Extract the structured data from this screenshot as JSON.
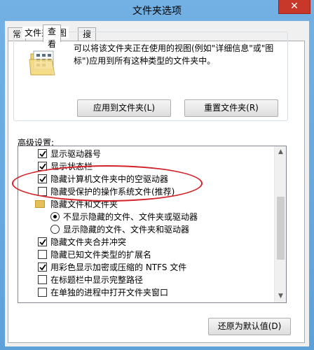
{
  "window": {
    "title": "文件夹选项",
    "close_glyph": "✕"
  },
  "tabs": [
    {
      "label": "常规",
      "active": false
    },
    {
      "label": "查看",
      "active": true
    },
    {
      "label": "搜索",
      "active": false
    }
  ],
  "folder_views": {
    "title": "文件夹视图",
    "description": "可以将该文件夹正在使用的视图(例如\"详细信息\"或\"图标\")应用到所有这种类型的文件夹中。",
    "apply_button": "应用到文件夹(L)",
    "reset_button": "重置文件夹(R)"
  },
  "advanced": {
    "label": "高级设置:",
    "items": [
      {
        "type": "checkbox",
        "label": "显示驱动器号",
        "checked": true
      },
      {
        "type": "checkbox",
        "label": "显示状态栏",
        "checked": true
      },
      {
        "type": "checkbox",
        "label": "隐藏计算机文件夹中的空驱动器",
        "checked": true
      },
      {
        "type": "checkbox",
        "label": "隐藏受保护的操作系统文件(推荐)",
        "checked": false
      },
      {
        "type": "folder",
        "label": "隐藏文件和文件夹"
      },
      {
        "type": "radio",
        "label": "不显示隐藏的文件、文件夹或驱动器",
        "selected": true
      },
      {
        "type": "radio",
        "label": "显示隐藏的文件、文件夹和驱动器",
        "selected": false
      },
      {
        "type": "checkbox",
        "label": "隐藏文件夹合并冲突",
        "checked": true
      },
      {
        "type": "checkbox",
        "label": "隐藏已知文件类型的扩展名",
        "checked": false
      },
      {
        "type": "checkbox",
        "label": "用彩色显示加密或压缩的 NTFS 文件",
        "checked": true
      },
      {
        "type": "checkbox",
        "label": "在标题栏中显示完整路径",
        "checked": false
      },
      {
        "type": "checkbox",
        "label": "在单独的进程中打开文件夹窗口",
        "checked": false
      }
    ],
    "restore_button": "还原为默认值(D)"
  },
  "colors": {
    "annotation": "#d2232a",
    "titlebar": "#6aa7d8",
    "close": "#c7382a"
  }
}
